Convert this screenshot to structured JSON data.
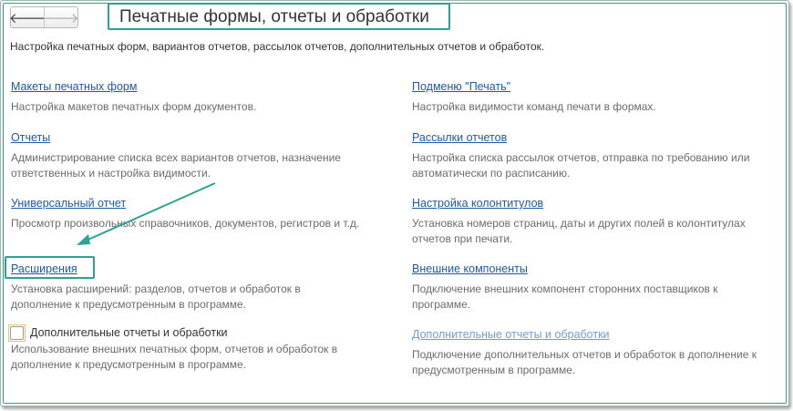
{
  "header": {
    "back_icon": "arrow-left-icon",
    "forward_icon": "arrow-right-icon",
    "title": "Печатные формы, отчеты и обработки"
  },
  "intro": "Настройка печатных форм, вариантов отчетов, рассылок отчетов, дополнительных отчетов и обработок.",
  "left_items": [
    {
      "link": "Макеты печатных форм",
      "desc": "Настройка макетов печатных форм документов."
    },
    {
      "link": "Отчеты",
      "desc": "Администрирование списка всех вариантов отчетов, назначение ответственных и настройка видимости."
    },
    {
      "link": "Универсальный отчет",
      "desc": "Просмотр произвольных справочников, документов, регистров и т.д."
    },
    {
      "link": "Расширения",
      "desc": "Установка расширений: разделов, отчетов и обработок в дополнение к предусмотренным в программе."
    }
  ],
  "checkbox": {
    "label": "Дополнительные отчеты и обработки",
    "checked": false,
    "desc": "Использование внешних печатных форм, отчетов и обработок в дополнение к предусмотренным в программе."
  },
  "right_items": [
    {
      "link": "Подменю \"Печать\"",
      "desc": "Настройка видимости команд печати в формах."
    },
    {
      "link": "Рассылки отчетов",
      "desc": "Настройка списка рассылок отчетов, отправка по требованию или автоматически по расписанию."
    },
    {
      "link": "Настройка колонтитулов",
      "desc": "Установка номеров страниц, даты и других полей в колонтитулах отчетов при печати."
    },
    {
      "link": "Внешние компоненты",
      "desc": "Подключение внешних компонент сторонних поставщиков к программе."
    },
    {
      "link": "Дополнительные отчеты и обработки",
      "desc": "Подключение дополнительных отчетов и обработок в дополнение к предусмотренным в программе."
    }
  ],
  "colors": {
    "accent": "#2aa394",
    "link": "#1e5aa8",
    "link_disabled": "#6f9ed4"
  }
}
